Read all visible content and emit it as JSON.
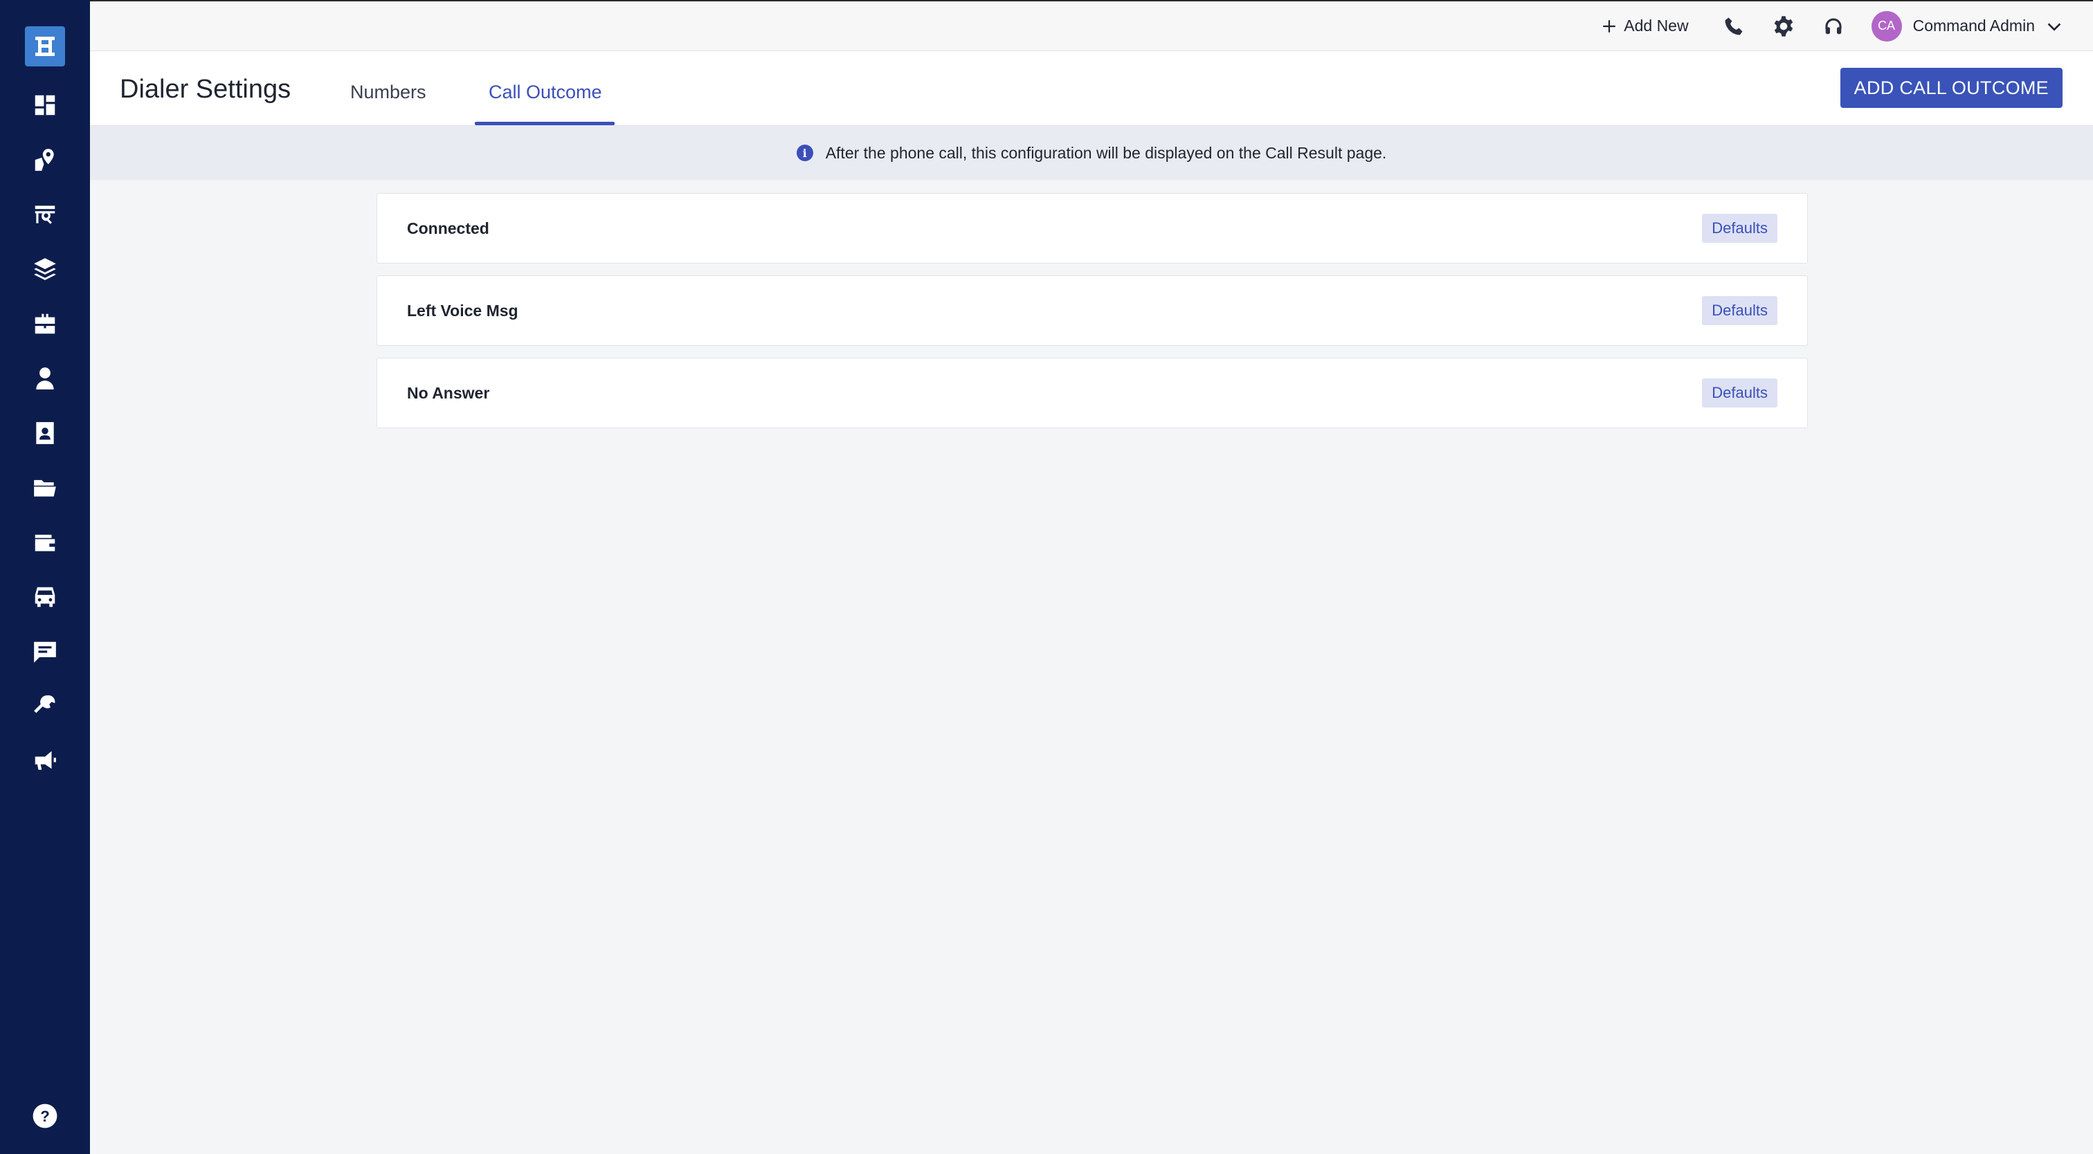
{
  "topbar": {
    "add_new_label": "Add New",
    "user_initials": "CA",
    "user_name": "Command Admin"
  },
  "header": {
    "title": "Dialer Settings",
    "tabs": [
      {
        "label": "Numbers",
        "active": false
      },
      {
        "label": "Call Outcome",
        "active": true
      }
    ],
    "add_button_label": "ADD CALL OUTCOME"
  },
  "banner": {
    "text": "After the phone call, this configuration will be displayed on the Call Result page."
  },
  "outcomes": [
    {
      "label": "Connected",
      "badge": "Defaults"
    },
    {
      "label": "Left Voice Msg",
      "badge": "Defaults"
    },
    {
      "label": "No Answer",
      "badge": "Defaults"
    }
  ],
  "sidebar": {
    "items": [
      {
        "icon": "dashboard-icon"
      },
      {
        "icon": "map-pin-icon"
      },
      {
        "icon": "store-search-icon"
      },
      {
        "icon": "layers-icon"
      },
      {
        "icon": "briefcase-icon"
      },
      {
        "icon": "user-icon"
      },
      {
        "icon": "contact-card-icon"
      },
      {
        "icon": "folder-icon"
      },
      {
        "icon": "wallet-icon"
      },
      {
        "icon": "truck-icon"
      },
      {
        "icon": "message-icon"
      },
      {
        "icon": "wrench-icon"
      },
      {
        "icon": "megaphone-icon"
      }
    ],
    "help_icon": "help-icon"
  },
  "colors": {
    "sidebar_bg": "#0c1d4d",
    "accent": "#3b4fb8",
    "avatar": "#b266c8"
  }
}
